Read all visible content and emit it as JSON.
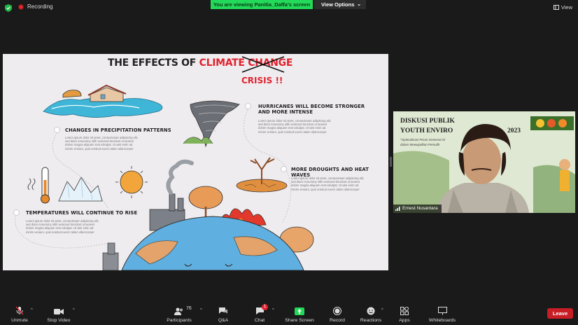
{
  "topbar": {
    "recording_label": "Recording",
    "viewing_banner": "You are viewing Panitia_Daffa's screen",
    "view_options_label": "View Options",
    "view_label": "View"
  },
  "slide": {
    "title_prefix": "THE EFFECTS OF",
    "title_red": "CLIMATE",
    "title_struck": "CHANGE",
    "crisis": "CRISIS !!",
    "sections": [
      {
        "heading": "CHANGES IN PRECIPITATION PATTERNS",
        "body": [
          "Lorem ipsum dolor sit amet, consectetuer adipiscing elit,",
          "sed diam nonummy nibh euismod tincidunt ut laoreet",
          "dolore magna aliquam erat volutpat. Ut wisi enim ad",
          "minim veniam, quis nostrud exerci tation ullamcorper"
        ]
      },
      {
        "heading": "HURRICANES WILL BECOME STRONGER",
        "heading2": "AND MORE INTENSE",
        "body": [
          "Lorem ipsum dolor sit amet, consectetuer adipiscing elit,",
          "sed diam nonummy nibh euismod tincidunt ut laoreet",
          "dolore magna aliquam erat volutpat. Ut wisi enim ad",
          "minim veniam, quis nostrud exerci tation ullamcorper"
        ]
      },
      {
        "heading": "MORE DROUGHTS AND HEAT WAVES",
        "body": [
          "Lorem ipsum dolor sit amet, consectetuer adipiscing elit,",
          "sed diam nonummy nibh euismod tincidunt ut laoreet",
          "dolore magna aliquam erat volutpat. Ut wisi enim ad",
          "minim veniam, quis nostrud exerci tation ullamcorper"
        ]
      },
      {
        "heading": "TEMPERATURES WILL CONTINUE TO RISE",
        "body": [
          "Lorem ipsum dolor sit amet, consectetuer adipiscing elit,",
          "sed diam nonummy nibh euismod tincidunt ut laoreet",
          "dolore magna aliquam erat volutpat. Ut wisi enim ad",
          "minim veniam, quis nostrud exerci tation ullamcorper"
        ]
      }
    ]
  },
  "video": {
    "line1": "DISKUSI PUBLIK",
    "line2": "YOUTH ENVIRO",
    "line2_year": "2023",
    "sub1": "\"Optimalisasi Peran Generasi M",
    "sub2": "dalam Mewujudkan Pemulih",
    "participant_name": "Ernest Nusantara"
  },
  "toolbar": {
    "unmute": "Unmute",
    "stop_video": "Stop Video",
    "participants": "Participants",
    "participants_count": "76",
    "qa": "Q&A",
    "chat": "Chat",
    "chat_badge": "1",
    "share_screen": "Share Screen",
    "record": "Record",
    "reactions": "Reactions",
    "apps": "Apps",
    "whiteboards": "Whiteboards",
    "leave": "Leave"
  },
  "colors": {
    "accent_green": "#23d959",
    "leave_red": "#c81d25",
    "title_red": "#e0232f"
  }
}
